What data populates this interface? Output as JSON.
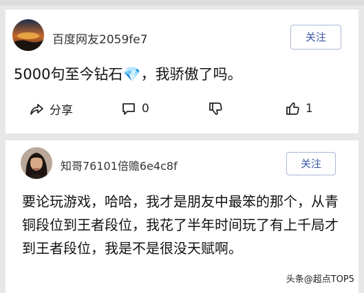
{
  "posts": [
    {
      "username": "百度网友2059fe7",
      "follow_label": "关注",
      "content_before": "5000句至今钻石",
      "content_emoji": "💎",
      "content_after": "，我骄傲了吗。",
      "actions": {
        "share_label": "分享",
        "comment_count": "0",
        "like_count": "1"
      }
    },
    {
      "username": "知哥76101倍赡6e4c8f",
      "follow_label": "关注",
      "content": "要论玩游戏，哈哈，我才是朋友中最笨的那个，从青铜段位到王者段位，我花了半年时间玩了有上千局才到王者段位，我是不是很没天赋啊。"
    }
  ],
  "watermark": "头条@超点TOP5",
  "icons": [
    "share-icon",
    "comment-icon",
    "dislike-icon",
    "like-icon"
  ],
  "colors": {
    "follow_accent": "#3b57a8",
    "background": "#e7e7e7"
  }
}
